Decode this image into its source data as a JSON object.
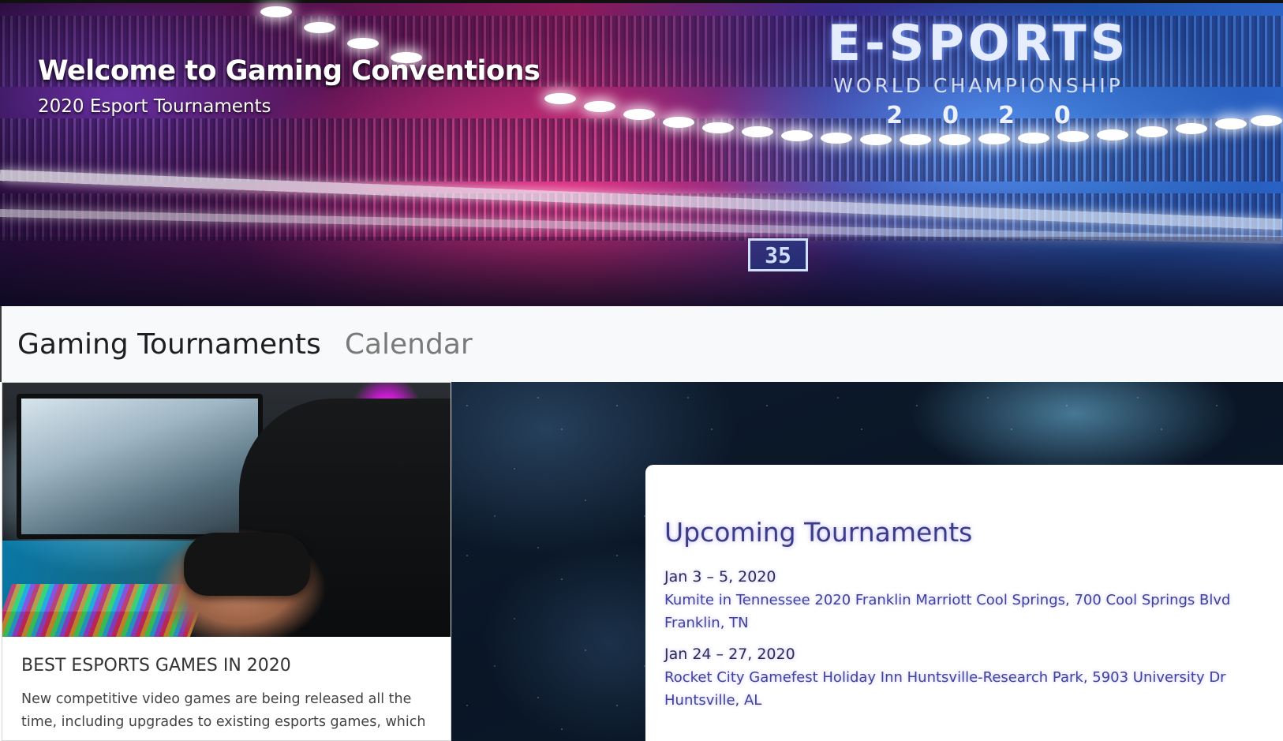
{
  "hero": {
    "title": "Welcome to Gaming Conventions",
    "subtitle": "2020 Esport Tournaments",
    "banner_logo": {
      "line1": "E-SPORTS",
      "line2": "WORLD CHAMPIONSHIP",
      "line3": "2020"
    },
    "screen_number": "35"
  },
  "navbar": {
    "brand": "Gaming Tournaments",
    "links": [
      {
        "label": "Calendar"
      }
    ]
  },
  "card": {
    "image_alt_icon": "gamepad-photo",
    "title": "BEST ESPORTS GAMES IN 2020",
    "text": "New competitive video games are being released all the time, including upgrades to existing esports games, which"
  },
  "tournaments": {
    "heading": "Upcoming Tournaments",
    "events": [
      {
        "date": "Jan 3 – 5, 2020",
        "line1": "Kumite in Tennessee 2020 Franklin Marriott Cool Springs, 700 Cool Springs Blvd",
        "line2": "Franklin, TN"
      },
      {
        "date": "Jan 24 – 27, 2020",
        "line1": "Rocket City Gamefest Holiday Inn Huntsville-Research Park, 5903 University Dr",
        "line2": "Huntsville, AL"
      }
    ]
  },
  "colors": {
    "navbar_bg": "#f8f9fa",
    "brand_text": "#1f1f1f",
    "nav_link_text": "#7a7a7a",
    "tournament_heading": "#3b3d86",
    "tournament_text": "#3f4498"
  }
}
